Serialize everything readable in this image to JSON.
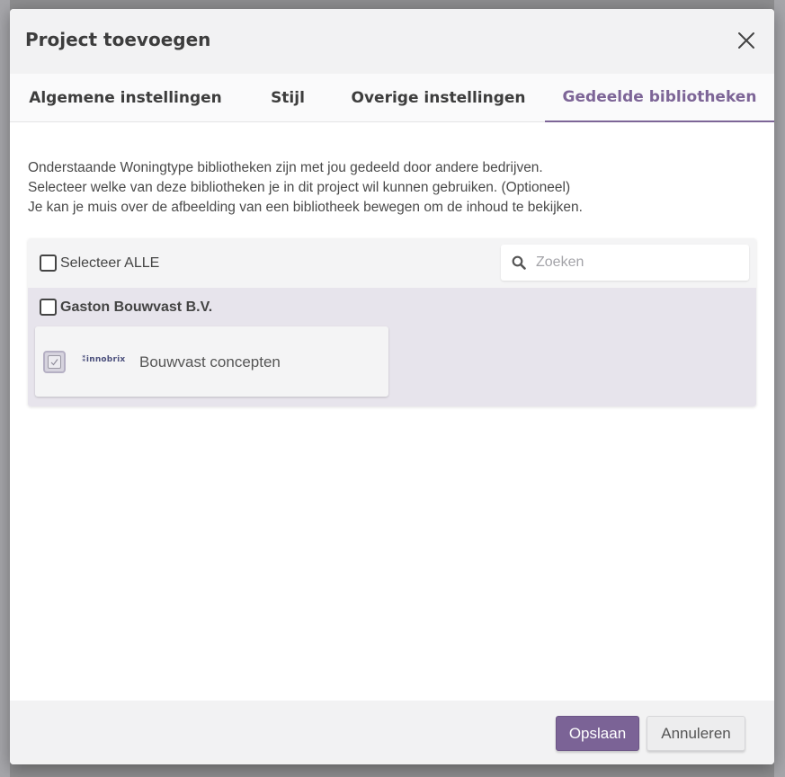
{
  "modal": {
    "title": "Project toevoegen",
    "close_icon": "close-icon"
  },
  "tabs": [
    {
      "label": "Algemene instellingen",
      "active": false
    },
    {
      "label": "Stijl",
      "active": false
    },
    {
      "label": "Overige instellingen",
      "active": false
    },
    {
      "label": "Gedeelde bibliotheken",
      "active": true
    }
  ],
  "intro": {
    "line1": "Onderstaande Woningtype bibliotheken zijn met jou gedeeld door andere bedrijven.",
    "line2": "Selecteer welke van deze bibliotheken je in dit project wil kunnen gebruiken. (Optioneel)",
    "line3": "Je kan je muis over de afbeelding van een bibliotheek bewegen om de inhoud te bekijken."
  },
  "select_all": {
    "label": "Selecteer ALLE",
    "checked": false
  },
  "search": {
    "placeholder": "Zoeken",
    "value": "",
    "icon": "search-icon"
  },
  "groups": [
    {
      "company": "Gaston Bouwvast B.V.",
      "checked": false,
      "libraries": [
        {
          "logo_text": "innobrix",
          "label": "Bouwvast concepten",
          "checked": true,
          "disabled": true
        }
      ]
    }
  ],
  "footer": {
    "save_label": "Opslaan",
    "cancel_label": "Annuleren"
  },
  "colors": {
    "accent": "#7b6396",
    "group_background": "#e7e4ec",
    "header_background": "#f2f2f3"
  }
}
